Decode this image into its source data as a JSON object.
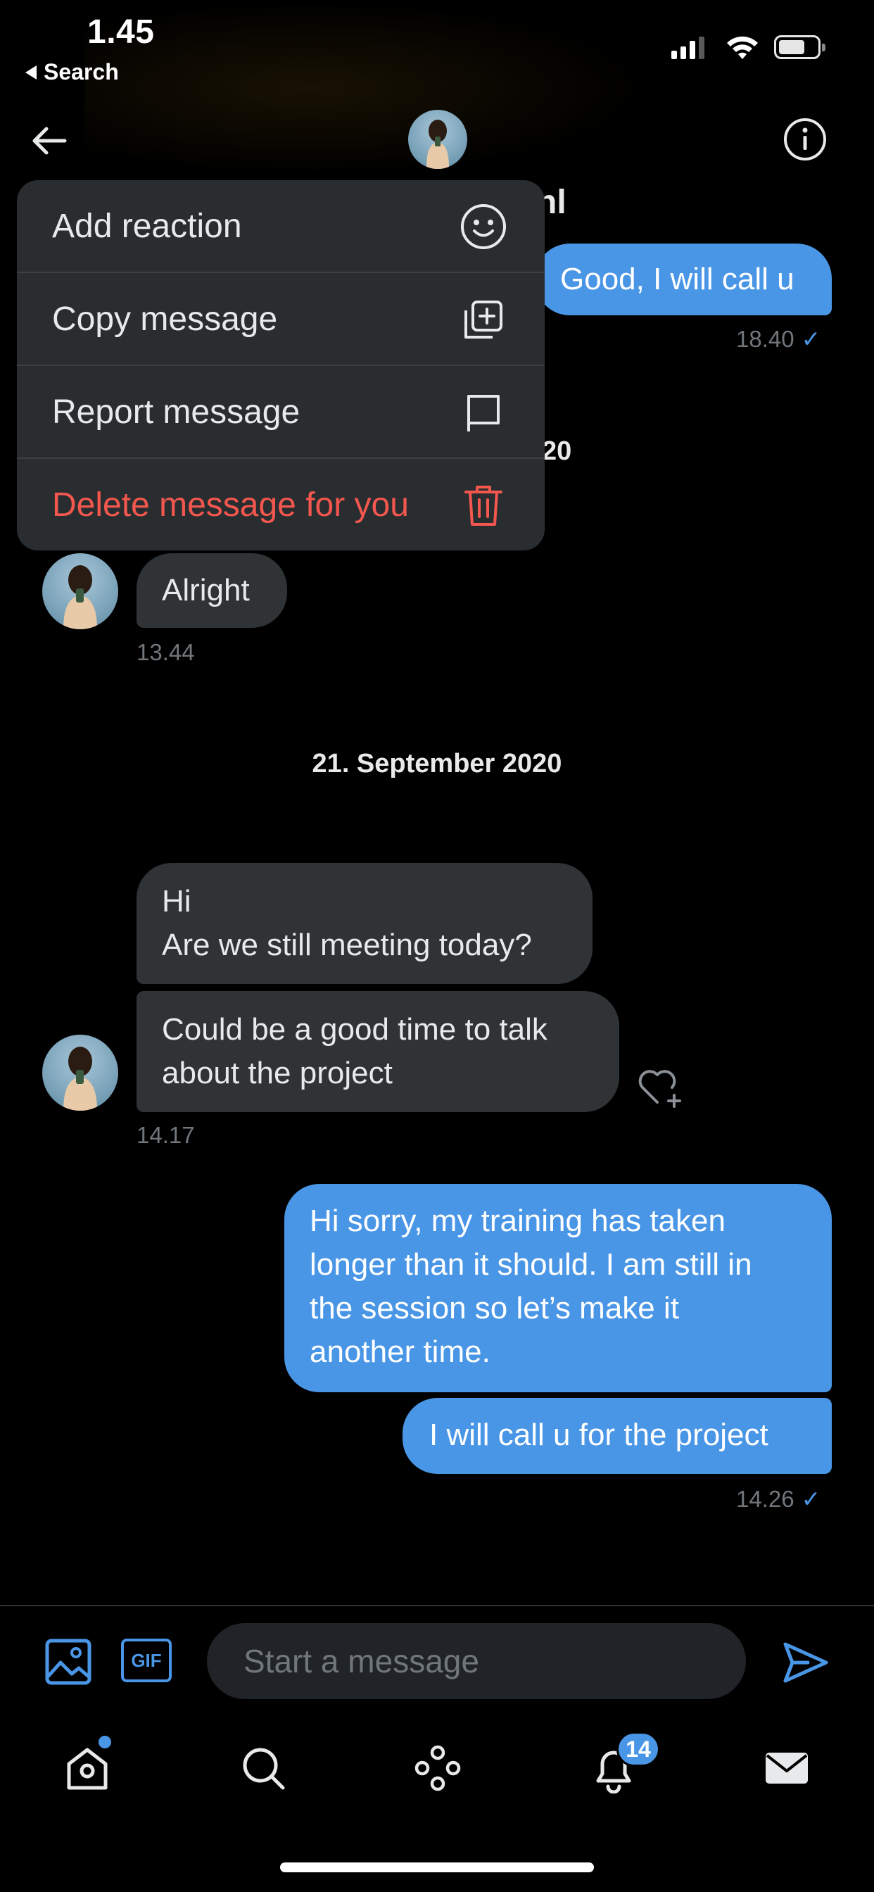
{
  "status_bar": {
    "time": "1.45",
    "back_app": "Search"
  },
  "header": {
    "title_fragment": "nl"
  },
  "context_menu": {
    "items": [
      {
        "label": "Add reaction",
        "icon": "smiley-icon"
      },
      {
        "label": "Copy message",
        "icon": "copy-plus-icon"
      },
      {
        "label": "Report message",
        "icon": "flag-icon"
      },
      {
        "label": "Delete message for you",
        "icon": "trash-icon",
        "danger": true
      }
    ]
  },
  "conversation": {
    "partial_date_fragment": "20",
    "messages": [
      {
        "direction": "out",
        "text": "Good, I will call u",
        "time": "18.40",
        "read": true
      },
      {
        "direction": "in",
        "text": "Alright",
        "time": "13.44"
      },
      {
        "direction": "in",
        "lines": [
          "Hi",
          "Are we still meeting today?"
        ]
      },
      {
        "direction": "in",
        "lines": [
          "Could be a good time to talk",
          "about the project"
        ],
        "time": "14.17"
      },
      {
        "direction": "out",
        "lines": [
          "Hi sorry, my training has taken",
          "longer than it should. I am still in",
          "the session so let’s make it",
          "another time."
        ]
      },
      {
        "direction": "out",
        "text": "I will call u for the project",
        "time": "14.26",
        "read": true
      }
    ],
    "date_separator": "21. September 2020"
  },
  "composer": {
    "placeholder": "Start a message",
    "gif_label": "GIF"
  },
  "tab_bar": {
    "items": [
      "home-icon",
      "search-icon",
      "spaces-icon",
      "notifications-icon",
      "messages-icon"
    ],
    "notification_count": "14"
  },
  "colors": {
    "accent": "#4a96e6",
    "danger": "#f4574e",
    "incoming_bubble": "#2f3336",
    "menu_background": "#2a2d30"
  }
}
